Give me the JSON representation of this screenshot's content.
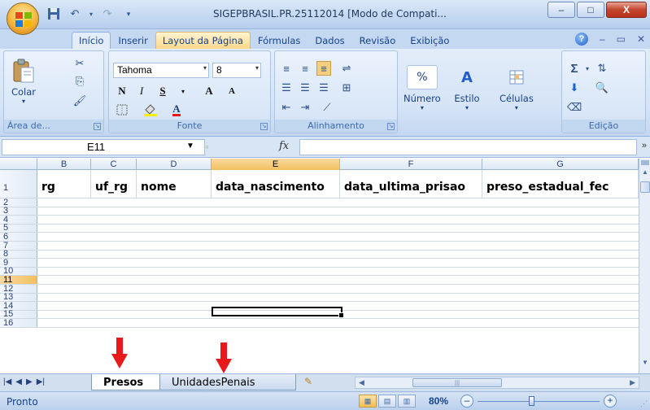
{
  "window": {
    "title": "SIGEPBRASIL.PR.25112014  [Modo de Compati...",
    "controls": {
      "minimize": "–",
      "maximize": "□",
      "close": "X"
    }
  },
  "quick_access": {
    "save_icon": "save-icon",
    "undo_icon": "undo-icon",
    "redo_icon": "redo-icon"
  },
  "tabs": [
    "Início",
    "Inserir",
    "Layout da Página",
    "Fórmulas",
    "Dados",
    "Revisão",
    "Exibição"
  ],
  "ribbon": {
    "clipboard": {
      "paste_label": "Colar",
      "group_label": "Área de..."
    },
    "font": {
      "name": "Tahoma",
      "size": "8",
      "bold": "N",
      "italic": "I",
      "underline": "S",
      "grow": "A",
      "shrink": "A",
      "group_label": "Fonte"
    },
    "alignment": {
      "group_label": "Alinhamento"
    },
    "number": {
      "format": "%",
      "label": "Número"
    },
    "style": {
      "label": "Estilo"
    },
    "cells": {
      "label": "Células"
    },
    "editing": {
      "group_label": "Edição",
      "sum": "Σ"
    }
  },
  "formula_bar": {
    "name_box": "E11",
    "fx": "fx",
    "formula": ""
  },
  "columns": [
    {
      "letter": "B",
      "selected": false
    },
    {
      "letter": "C",
      "selected": false
    },
    {
      "letter": "D",
      "selected": false
    },
    {
      "letter": "E",
      "selected": true
    },
    {
      "letter": "F",
      "selected": false
    },
    {
      "letter": "G",
      "selected": false
    }
  ],
  "header_row": [
    "rg",
    "uf_rg",
    "nome",
    "data_nascimento",
    "data_ultima_prisao",
    "preso_estadual_fec"
  ],
  "row_numbers": [
    "1",
    "2",
    "3",
    "4",
    "5",
    "6",
    "7",
    "8",
    "9",
    "10",
    "11",
    "12",
    "13",
    "14",
    "15",
    "16"
  ],
  "selected_row": "11",
  "sheets": {
    "active": "Presos",
    "other": "UnidadesPenais"
  },
  "status": {
    "text": "Pronto",
    "zoom": "80%"
  },
  "colors": {
    "ribbon_bg": "#dbe7f6",
    "accent_arrow": "#e8191b",
    "selected_header": "#f1c15f"
  }
}
